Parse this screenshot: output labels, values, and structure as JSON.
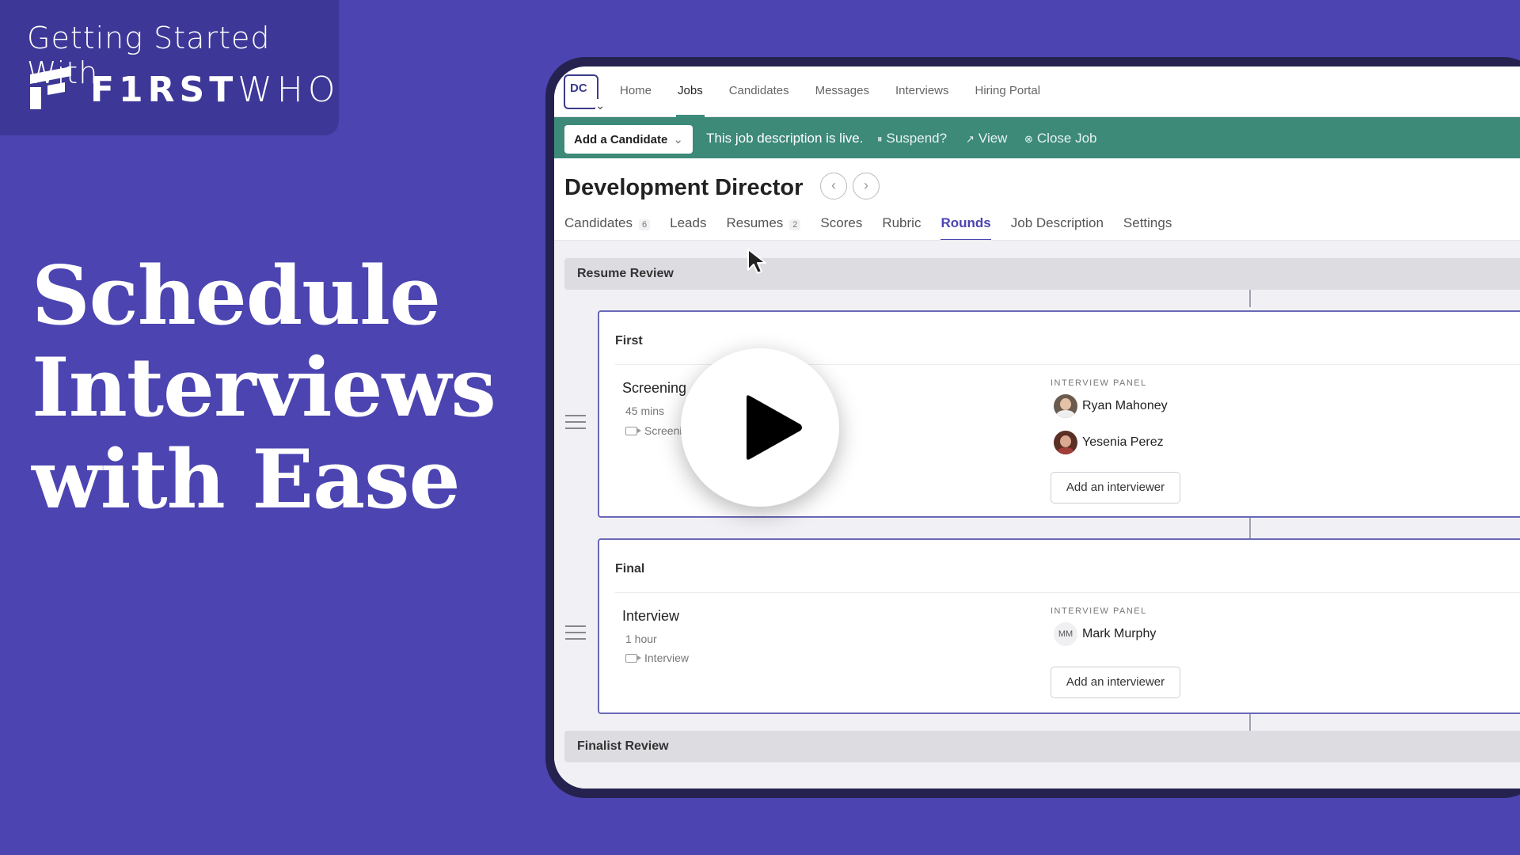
{
  "brand": {
    "tagline": "Getting Started With",
    "wordmark_bold": "F1RST",
    "wordmark_light": "WHO"
  },
  "headline": [
    "Schedule",
    "Interviews",
    "with Ease"
  ],
  "colors": {
    "background": "#4B44B1",
    "badge": "#3D3797",
    "live_bar": "#3D8A79",
    "accent": "#4B44B1"
  },
  "app": {
    "org_initials": "DC",
    "nav": [
      "Home",
      "Jobs",
      "Candidates",
      "Messages",
      "Interviews",
      "Hiring Portal"
    ],
    "nav_active": "Jobs",
    "live_bar": {
      "add_candidate": "Add a Candidate",
      "status": "This job description is live.",
      "suspend": "Suspend?",
      "view": "View",
      "close_job": "Close Job"
    },
    "job_title": "Development Director",
    "tabs": [
      {
        "label": "Candidates",
        "count": "6"
      },
      {
        "label": "Leads",
        "count": ""
      },
      {
        "label": "Resumes",
        "count": "2"
      },
      {
        "label": "Scores",
        "count": ""
      },
      {
        "label": "Rubric",
        "count": ""
      },
      {
        "label": "Rounds",
        "count": ""
      },
      {
        "label": "Job Description",
        "count": ""
      },
      {
        "label": "Settings",
        "count": ""
      }
    ],
    "active_tab": "Rounds",
    "stages": {
      "first_stage": "Resume Review",
      "last_stage": "Finalist Review"
    },
    "rounds": [
      {
        "name": "First",
        "interview": "Screening",
        "duration": "45 mins",
        "type": "Screening",
        "panel_label": "INTERVIEW PANEL",
        "interviewers": [
          {
            "name": "Ryan Mahoney",
            "avatar": "photo"
          },
          {
            "name": "Yesenia Perez",
            "avatar": "photo"
          }
        ],
        "add_label": "Add an interviewer"
      },
      {
        "name": "Final",
        "interview": "Interview",
        "duration": "1 hour",
        "type": "Interview",
        "panel_label": "INTERVIEW PANEL",
        "interviewers": [
          {
            "name": "Mark Murphy",
            "initials": "MM"
          }
        ],
        "add_label": "Add an interviewer"
      }
    ]
  },
  "icons": {
    "play": "play-icon",
    "cursor": "mouse-pointer-icon",
    "drag": "drag-handle-icon",
    "camera": "video-camera-icon"
  }
}
